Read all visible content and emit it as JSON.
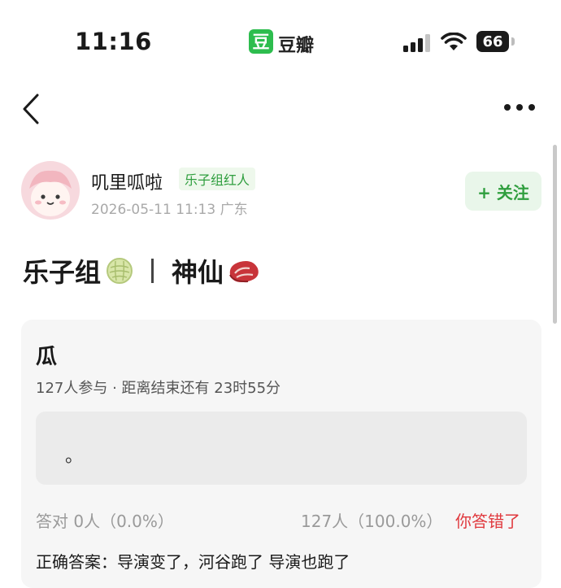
{
  "status_bar": {
    "time": "11:16",
    "app_logo": "豆",
    "app_name": "豆瓣",
    "battery": "66"
  },
  "nav": {
    "back_icon": "chevron-left-icon",
    "more_icon": "more-dots-icon"
  },
  "author": {
    "name": "叽里呱啦",
    "badge": "乐子组红人",
    "date": "2026-05-11 11:13",
    "location": "广东",
    "follow_label": "+ 关注"
  },
  "post": {
    "title_left": "乐子组",
    "title_right": "神仙"
  },
  "poll": {
    "title": "瓜",
    "meta": "127人参与 · 距离结束还有 23时55分",
    "option_text": "。",
    "correct_stat": "答对  0人（0.0%）",
    "total_stat": "127人（100.0%）",
    "result": "你答错了",
    "answer": "正确答案：导演变了，河谷跑了 导演也跑了"
  },
  "colors": {
    "accent_green": "#2f9e3e",
    "error_red": "#e0393e"
  }
}
